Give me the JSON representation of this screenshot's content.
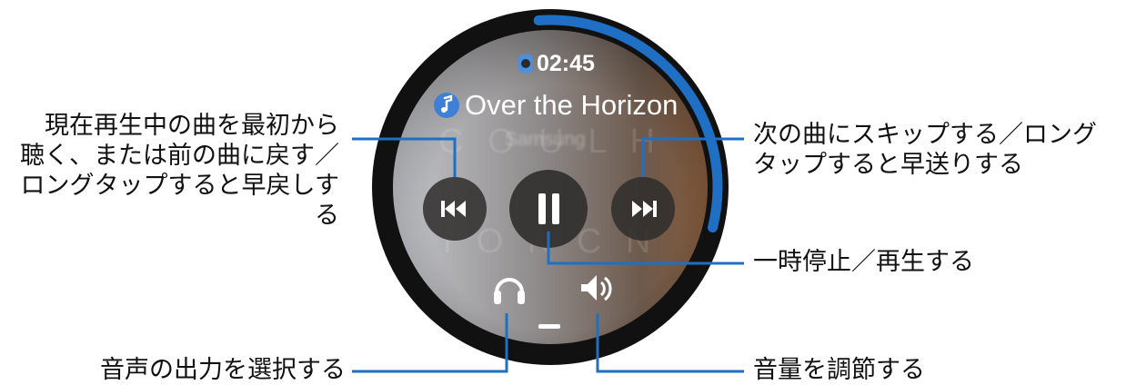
{
  "watch": {
    "status": {
      "icon": "watch-icon",
      "time": "02:45"
    },
    "track": {
      "icon": "music-note-icon",
      "title": "Over the Horizon",
      "artist": "Samsung"
    },
    "controls": {
      "previous": {
        "icon": "skip-previous-icon"
      },
      "play_pause": {
        "icon": "pause-icon"
      },
      "next": {
        "icon": "skip-next-icon"
      }
    },
    "bottom": {
      "output_icon": "headphones-icon",
      "volume_icon": "speaker-volume-icon"
    },
    "progress_fraction": 0.3,
    "colors": {
      "accent": "#1f6fc4",
      "bezel": "#111111"
    }
  },
  "annotations": {
    "previous": "現在再生中の曲を最初から\n聴く、または前の曲に戻す／\nロングタップすると早戻しす\nる",
    "next": "次の曲にスキップする／ロング\nタップすると早送りする",
    "pause": "一時停止／再生する",
    "output": "音声の出力を選択する",
    "volume": "音量を調節する"
  }
}
